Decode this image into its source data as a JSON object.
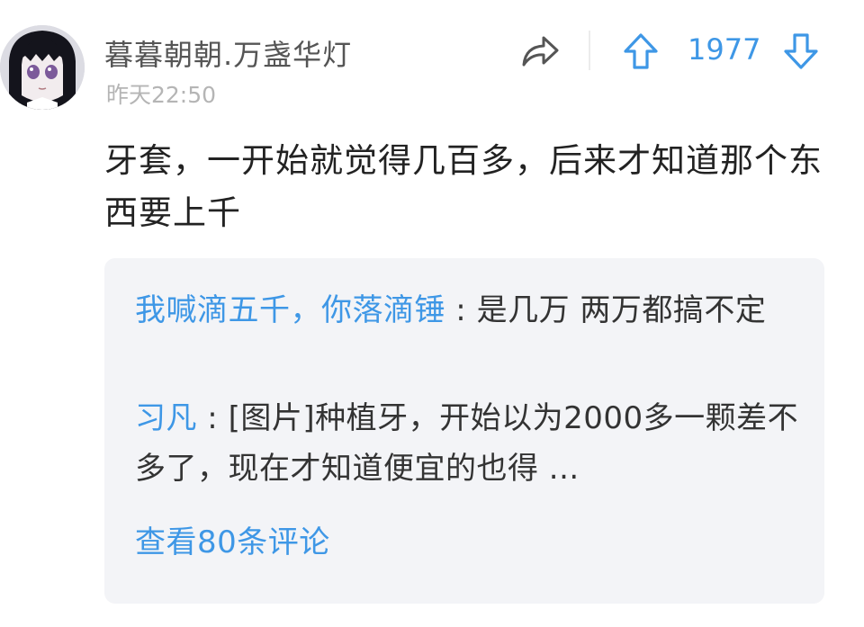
{
  "comment": {
    "username": "暮暮朝朝.万盏华灯",
    "timestamp": "昨天22:50",
    "vote_count": "1977",
    "content": "牙套，一开始就觉得几百多，后来才知道那个东西要上千"
  },
  "replies": [
    {
      "author": "我喊滴五千，你落滴锤",
      "separator": " : ",
      "text": "是几万 两万都搞不定"
    },
    {
      "author": "习凡",
      "separator": " : ",
      "text": "[图片]种植牙，开始以为2000多一颗差不多了，现在才知道便宜的也得 ..."
    }
  ],
  "view_more": "查看80条评论",
  "icons": {
    "share": "share-arrow-icon",
    "upvote": "arrow-up-icon",
    "downvote": "arrow-down-icon"
  },
  "colors": {
    "accent": "#3e97e6",
    "username": "#555555",
    "timestamp": "#b5b5b5",
    "reply_bg": "#f3f4f7"
  }
}
